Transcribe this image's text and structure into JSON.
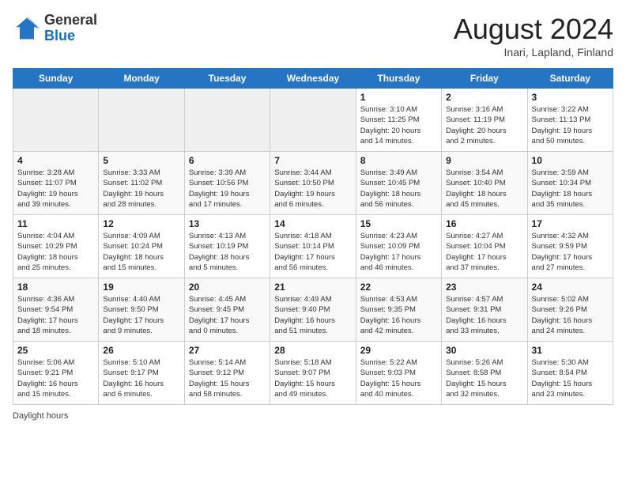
{
  "logo": {
    "general": "General",
    "blue": "Blue"
  },
  "title": {
    "month_year": "August 2024",
    "location": "Inari, Lapland, Finland"
  },
  "days_of_week": [
    "Sunday",
    "Monday",
    "Tuesday",
    "Wednesday",
    "Thursday",
    "Friday",
    "Saturday"
  ],
  "footer": {
    "label": "Daylight hours"
  },
  "weeks": [
    [
      {
        "day": "",
        "info": ""
      },
      {
        "day": "",
        "info": ""
      },
      {
        "day": "",
        "info": ""
      },
      {
        "day": "",
        "info": ""
      },
      {
        "day": "1",
        "info": "Sunrise: 3:10 AM\nSunset: 11:25 PM\nDaylight: 20 hours\nand 14 minutes."
      },
      {
        "day": "2",
        "info": "Sunrise: 3:16 AM\nSunset: 11:19 PM\nDaylight: 20 hours\nand 2 minutes."
      },
      {
        "day": "3",
        "info": "Sunrise: 3:22 AM\nSunset: 11:13 PM\nDaylight: 19 hours\nand 50 minutes."
      }
    ],
    [
      {
        "day": "4",
        "info": "Sunrise: 3:28 AM\nSunset: 11:07 PM\nDaylight: 19 hours\nand 39 minutes."
      },
      {
        "day": "5",
        "info": "Sunrise: 3:33 AM\nSunset: 11:02 PM\nDaylight: 19 hours\nand 28 minutes."
      },
      {
        "day": "6",
        "info": "Sunrise: 3:39 AM\nSunset: 10:56 PM\nDaylight: 19 hours\nand 17 minutes."
      },
      {
        "day": "7",
        "info": "Sunrise: 3:44 AM\nSunset: 10:50 PM\nDaylight: 19 hours\nand 6 minutes."
      },
      {
        "day": "8",
        "info": "Sunrise: 3:49 AM\nSunset: 10:45 PM\nDaylight: 18 hours\nand 56 minutes."
      },
      {
        "day": "9",
        "info": "Sunrise: 3:54 AM\nSunset: 10:40 PM\nDaylight: 18 hours\nand 45 minutes."
      },
      {
        "day": "10",
        "info": "Sunrise: 3:59 AM\nSunset: 10:34 PM\nDaylight: 18 hours\nand 35 minutes."
      }
    ],
    [
      {
        "day": "11",
        "info": "Sunrise: 4:04 AM\nSunset: 10:29 PM\nDaylight: 18 hours\nand 25 minutes."
      },
      {
        "day": "12",
        "info": "Sunrise: 4:09 AM\nSunset: 10:24 PM\nDaylight: 18 hours\nand 15 minutes."
      },
      {
        "day": "13",
        "info": "Sunrise: 4:13 AM\nSunset: 10:19 PM\nDaylight: 18 hours\nand 5 minutes."
      },
      {
        "day": "14",
        "info": "Sunrise: 4:18 AM\nSunset: 10:14 PM\nDaylight: 17 hours\nand 56 minutes."
      },
      {
        "day": "15",
        "info": "Sunrise: 4:23 AM\nSunset: 10:09 PM\nDaylight: 17 hours\nand 46 minutes."
      },
      {
        "day": "16",
        "info": "Sunrise: 4:27 AM\nSunset: 10:04 PM\nDaylight: 17 hours\nand 37 minutes."
      },
      {
        "day": "17",
        "info": "Sunrise: 4:32 AM\nSunset: 9:59 PM\nDaylight: 17 hours\nand 27 minutes."
      }
    ],
    [
      {
        "day": "18",
        "info": "Sunrise: 4:36 AM\nSunset: 9:54 PM\nDaylight: 17 hours\nand 18 minutes."
      },
      {
        "day": "19",
        "info": "Sunrise: 4:40 AM\nSunset: 9:50 PM\nDaylight: 17 hours\nand 9 minutes."
      },
      {
        "day": "20",
        "info": "Sunrise: 4:45 AM\nSunset: 9:45 PM\nDaylight: 17 hours\nand 0 minutes."
      },
      {
        "day": "21",
        "info": "Sunrise: 4:49 AM\nSunset: 9:40 PM\nDaylight: 16 hours\nand 51 minutes."
      },
      {
        "day": "22",
        "info": "Sunrise: 4:53 AM\nSunset: 9:35 PM\nDaylight: 16 hours\nand 42 minutes."
      },
      {
        "day": "23",
        "info": "Sunrise: 4:57 AM\nSunset: 9:31 PM\nDaylight: 16 hours\nand 33 minutes."
      },
      {
        "day": "24",
        "info": "Sunrise: 5:02 AM\nSunset: 9:26 PM\nDaylight: 16 hours\nand 24 minutes."
      }
    ],
    [
      {
        "day": "25",
        "info": "Sunrise: 5:06 AM\nSunset: 9:21 PM\nDaylight: 16 hours\nand 15 minutes."
      },
      {
        "day": "26",
        "info": "Sunrise: 5:10 AM\nSunset: 9:17 PM\nDaylight: 16 hours\nand 6 minutes."
      },
      {
        "day": "27",
        "info": "Sunrise: 5:14 AM\nSunset: 9:12 PM\nDaylight: 15 hours\nand 58 minutes."
      },
      {
        "day": "28",
        "info": "Sunrise: 5:18 AM\nSunset: 9:07 PM\nDaylight: 15 hours\nand 49 minutes."
      },
      {
        "day": "29",
        "info": "Sunrise: 5:22 AM\nSunset: 9:03 PM\nDaylight: 15 hours\nand 40 minutes."
      },
      {
        "day": "30",
        "info": "Sunrise: 5:26 AM\nSunset: 8:58 PM\nDaylight: 15 hours\nand 32 minutes."
      },
      {
        "day": "31",
        "info": "Sunrise: 5:30 AM\nSunset: 8:54 PM\nDaylight: 15 hours\nand 23 minutes."
      }
    ]
  ]
}
